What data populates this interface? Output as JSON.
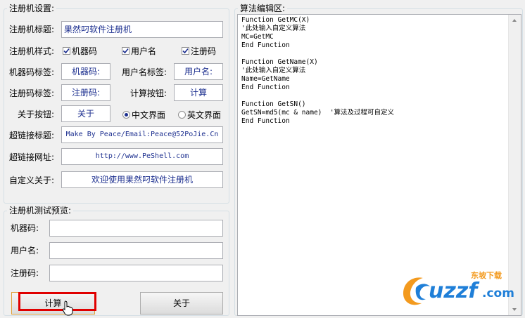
{
  "settings": {
    "title": "注册机设置:",
    "keygen_title_label": "注册机标题:",
    "keygen_title_value": "果然叼软件注册机",
    "style_label": "注册机样式:",
    "style_checks": [
      "机器码",
      "用户名",
      "注册码"
    ],
    "machine_code_label_label": "机器码标签:",
    "machine_code_label_value": "机器码:",
    "username_label_label": "用户名标签:",
    "username_label_value": "用户名:",
    "regcode_label_label": "注册码标签:",
    "regcode_label_value": "注册码:",
    "calc_button_label": "计算按钮:",
    "calc_button_value": "计算",
    "about_button_label": "关于按钮:",
    "about_button_value": "关于",
    "radio_chinese": "中文界面",
    "radio_english": "英文界面",
    "link_title_label": "超链接标题:",
    "link_title_value": "Make By Peace/Email:Peace@52PoJie.Cn",
    "link_url_label": "超链接网址:",
    "link_url_value": "http://www.PeShell.com",
    "custom_about_label": "自定义关于:",
    "custom_about_value": "欢迎使用果然叼软件注册机"
  },
  "preview": {
    "title": "注册机测试预览:",
    "machine_code_label": "机器码:",
    "username_label": "用户名:",
    "regcode_label": "注册码:",
    "calc_button": "计算",
    "about_button": "关于"
  },
  "algorithm": {
    "title": "算法编辑区:",
    "code": "Function GetMC(X)\n'此处输入自定义算法\nMC=GetMC\nEnd Function\n\nFunction GetName(X)\n'此处输入自定义算法\nName=GetName\nEnd Function\n\nFunction GetSN()\nGetSN=md5(mc & name)  '算法及过程可自定义\nEnd Function"
  },
  "watermark": {
    "brand": "uzzf",
    "tld": ".com",
    "tagline": "东坡下载"
  },
  "colors": {
    "value_text": "#1c2f8f",
    "highlight_box": "#e00000",
    "watermark_blue": "#1f7fd8",
    "watermark_orange": "#f39a1e"
  }
}
